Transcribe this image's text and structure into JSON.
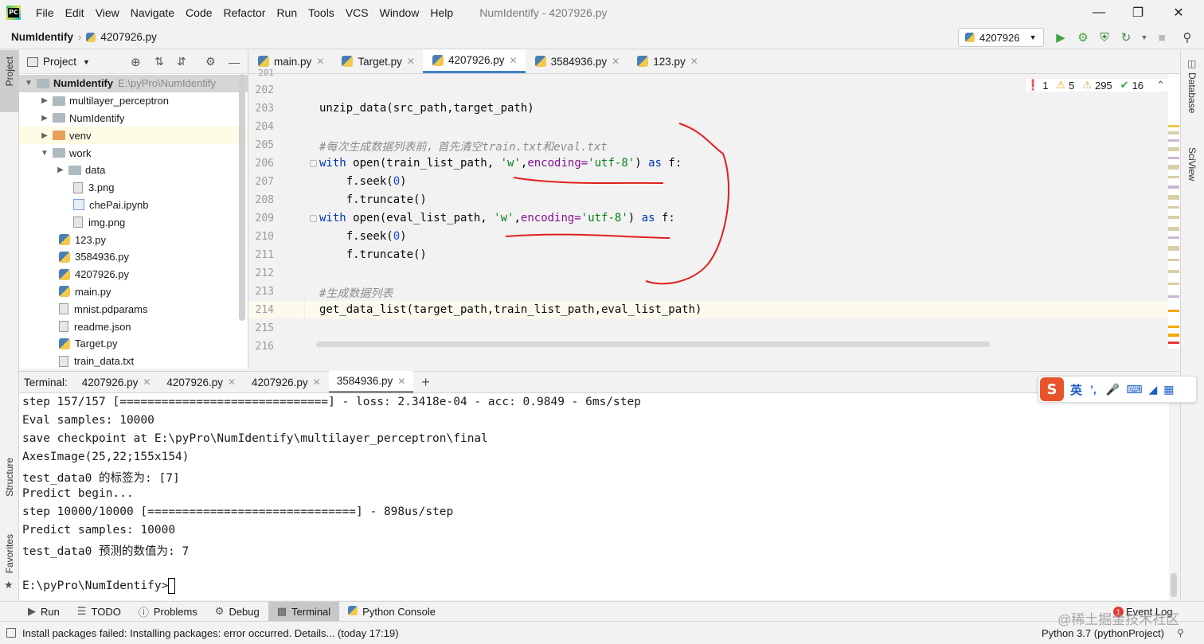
{
  "window": {
    "title": "NumIdentify - 4207926.py",
    "menu": [
      "File",
      "Edit",
      "View",
      "Navigate",
      "Code",
      "Refactor",
      "Run",
      "Tools",
      "VCS",
      "Window",
      "Help"
    ]
  },
  "navbar": {
    "project": "NumIdentify",
    "file": "4207926.py",
    "run_config": "4207926"
  },
  "left_strip": {
    "project": "Project",
    "structure": "Structure",
    "favorites": "Favorites"
  },
  "right_strip": {
    "database": "Database",
    "sciview": "SciView"
  },
  "project_panel": {
    "title": "Project",
    "root_name": "NumIdentify",
    "root_path": "E:\\pyPro\\NumIdentify",
    "items": [
      {
        "label": "multilayer_perceptron",
        "type": "folder"
      },
      {
        "label": "NumIdentify",
        "type": "folder"
      },
      {
        "label": "venv",
        "type": "folder-orange"
      },
      {
        "label": "work",
        "type": "folder"
      },
      {
        "label": "data",
        "type": "folder"
      },
      {
        "label": "3.png",
        "type": "file"
      },
      {
        "label": "chePai.ipynb",
        "type": "ipynb"
      },
      {
        "label": "img.png",
        "type": "file"
      },
      {
        "label": "123.py",
        "type": "py"
      },
      {
        "label": "3584936.py",
        "type": "py"
      },
      {
        "label": "4207926.py",
        "type": "py"
      },
      {
        "label": "main.py",
        "type": "py"
      },
      {
        "label": "mnist.pdparams",
        "type": "file"
      },
      {
        "label": "readme.json",
        "type": "file"
      },
      {
        "label": "Target.py",
        "type": "py"
      },
      {
        "label": "train_data.txt",
        "type": "file"
      }
    ]
  },
  "editor": {
    "tabs": [
      "main.py",
      "Target.py",
      "4207926.py",
      "3584936.py",
      "123.py"
    ],
    "active_tab": "4207926.py",
    "inspections": {
      "errors": "1",
      "warnings": "5",
      "weak": "295",
      "ok": "16"
    },
    "line_numbers": [
      "201",
      "202",
      "203",
      "204",
      "205",
      "206",
      "207",
      "208",
      "209",
      "210",
      "211",
      "212",
      "213",
      "214",
      "215",
      "216"
    ],
    "code": {
      "l203": "unzip_data(src_path,target_path)",
      "l205": "#每次生成数据列表前，首先清空train.txt和eval.txt",
      "l206_a": "with ",
      "l206_b": "open",
      "l206_c": "(train_list_path, ",
      "l206_d": "'w'",
      "l206_e": ",",
      "l206_f": "encoding=",
      "l206_g": "'utf-8'",
      "l206_h": ") ",
      "l206_i": "as",
      "l206_j": " f:",
      "l207_a": "    f.seek(",
      "l207_b": "0",
      "l207_c": ")",
      "l208": "    f.truncate()",
      "l209_a": "with ",
      "l209_b": "open",
      "l209_c": "(eval_list_path, ",
      "l209_d": "'w'",
      "l209_e": ",",
      "l209_f": "encoding=",
      "l209_g": "'utf-8'",
      "l209_h": ") ",
      "l209_i": "as",
      "l209_j": " f:",
      "l210_a": "    f.seek(",
      "l210_b": "0",
      "l210_c": ")",
      "l211": "    f.truncate()",
      "l213": "#生成数据列表",
      "l214": "get_data_list(target_path,train_list_path,eval_list_path)"
    }
  },
  "terminal": {
    "label": "Terminal:",
    "tabs": [
      "4207926.py",
      "4207926.py",
      "4207926.py",
      "3584936.py"
    ],
    "active_tab": "3584936.py",
    "lines": [
      "step 157/157 [==============================] - loss: 2.3418e-04 - acc: 0.9849 - 6ms/step",
      "Eval samples: 10000",
      "save checkpoint at E:\\pyPro\\NumIdentify\\multilayer_perceptron\\final",
      "AxesImage(25,22;155x154)",
      "test_data0 的标签为: [7]",
      "Predict begin...",
      "step 10000/10000 [==============================] - 898us/step",
      "Predict samples: 10000",
      "test_data0 预测的数值为: 7",
      "",
      "E:\\pyPro\\NumIdentify>"
    ]
  },
  "bottom_tools": [
    "Run",
    "TODO",
    "Problems",
    "Debug",
    "Terminal",
    "Python Console"
  ],
  "bottom_active": "Terminal",
  "event_log": {
    "label": "Event Log",
    "count": "1"
  },
  "status": {
    "message": "Install packages failed: Installing packages: error occurred. Details... (today 17:19)",
    "interpreter": "Python 3.7 (pythonProject)"
  },
  "ime": {
    "lang": "英",
    "punct": "’,"
  },
  "watermark": "@稀土掘金技术社区",
  "colors": {
    "accent": "#4083c9",
    "annotation": "#e0201c",
    "keyword": "#0033b3",
    "string": "#067d17"
  }
}
